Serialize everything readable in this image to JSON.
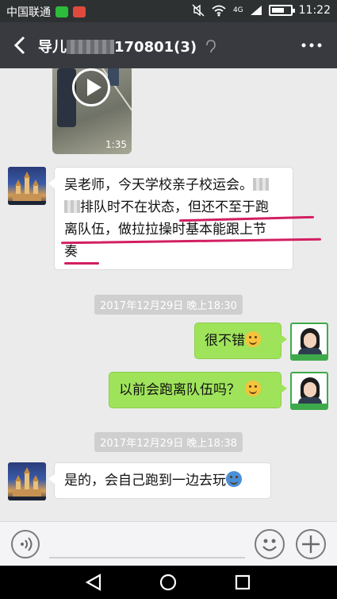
{
  "status_bar": {
    "carrier": "中国联通",
    "network": "4G",
    "time": "11:22"
  },
  "header": {
    "title": "导儿",
    "title_suffix": "170801(3)"
  },
  "video": {
    "duration": "1:35"
  },
  "messages": [
    {
      "side": "left",
      "line1": "吴老师，今天学校亲子校运会。",
      "line2a": "排队时不在状态，",
      "line2b": "但还不至于跑",
      "line3": "离队伍，做拉拉操时基本能跟上节",
      "line4": "奏"
    },
    {
      "side": "right",
      "text": "很不错"
    },
    {
      "side": "right",
      "text": "以前会跑离队伍吗？"
    },
    {
      "side": "left",
      "text": "是的，会自己跑到一边去玩"
    }
  ],
  "timestamps": [
    "2017年12月29日 晚上18:30",
    "2017年12月29日 晚上18:38"
  ],
  "colors": {
    "title_bar": "#393a3f",
    "bubble_green": "#9fe35b",
    "underline_mark": "#d21f62",
    "chat_bg": "#ebebeb"
  },
  "icons": [
    "back-arrow-icon",
    "more-icon",
    "earpiece-icon",
    "play-icon",
    "voice-icon",
    "emoji-icon",
    "plus-icon",
    "nav-back-icon",
    "nav-home-icon",
    "nav-recent-icon"
  ]
}
